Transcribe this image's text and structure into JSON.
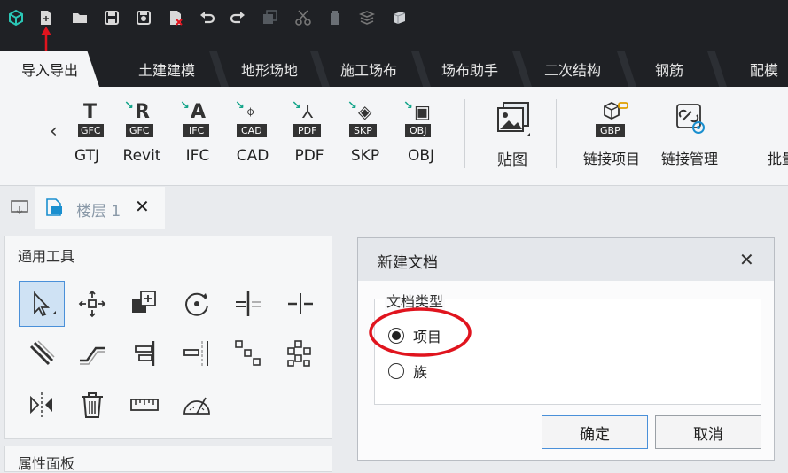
{
  "tabs": [
    "导入导出",
    "土建建模",
    "地形场地",
    "施工场布",
    "场布助手",
    "二次结构",
    "钢筋",
    "配模"
  ],
  "ribbon": {
    "nav_prev": "‹",
    "items": [
      {
        "badge": "GFC",
        "glyph": "T",
        "label": "GTJ"
      },
      {
        "badge": "GFC",
        "glyph": "R",
        "label": "Revit"
      },
      {
        "badge": "IFC",
        "glyph": "A",
        "label": "IFC"
      },
      {
        "badge": "CAD",
        "glyph": "⌖",
        "label": "CAD"
      },
      {
        "badge": "PDF",
        "glyph": "⅄",
        "label": "PDF"
      },
      {
        "badge": "SKP",
        "glyph": "◈",
        "label": "SKP"
      },
      {
        "badge": "OBJ",
        "glyph": "▣",
        "label": "OBJ"
      }
    ],
    "paste_label": "贴图",
    "link_project_badge": "GBP",
    "link_project_label": "链接项目",
    "link_manage_label": "链接管理",
    "batch_label": "批量"
  },
  "doc_tab": {
    "label": "楼层 1",
    "close": "✕"
  },
  "tools_panel": {
    "title": "通用工具"
  },
  "props_panel": {
    "title": "属性面板"
  },
  "dialog": {
    "title": "新建文档",
    "close": "✕",
    "group_label": "文档类型",
    "options": [
      {
        "label": "项目",
        "selected": true
      },
      {
        "label": "族",
        "selected": false
      }
    ],
    "ok": "确定",
    "cancel": "取消"
  },
  "colors": {
    "accent": "#1a8fcf",
    "annotation": "#e0141e",
    "dark": "#1f2125",
    "icon_green": "#14a58a"
  }
}
